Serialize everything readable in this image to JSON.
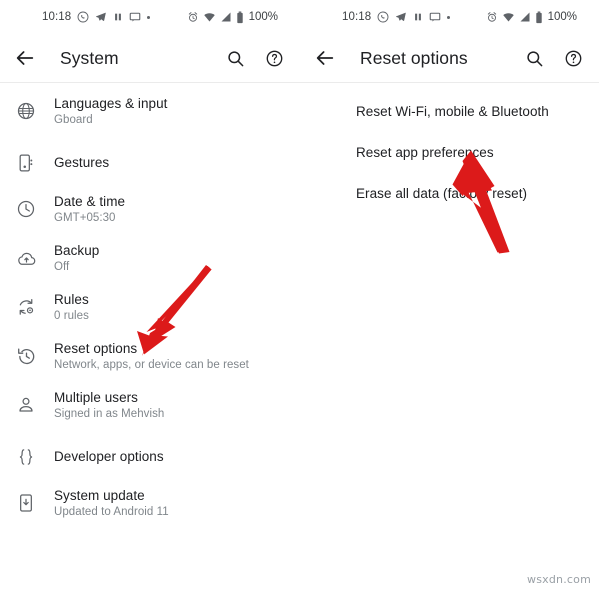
{
  "theme": {
    "accent_red": "#DC1A1A",
    "text_primary": "#202124",
    "text_secondary": "#80868b",
    "icon_color": "#5f6368",
    "background": "#ffffff",
    "divider": "#ebebeb"
  },
  "left_screen": {
    "status_bar": {
      "time": "10:18",
      "battery_percent": "100%",
      "left_icons": [
        "whatsapp-icon",
        "telegram-icon",
        "pause-icon",
        "message-icon",
        "more-notifications-dot"
      ],
      "right_icons": [
        "alarm-icon",
        "wifi-icon",
        "signal-icon",
        "battery-icon"
      ]
    },
    "app_bar": {
      "back_icon": "arrow-back-icon",
      "title": "System",
      "search_icon": "search-icon",
      "help_icon": "help-circle-icon"
    },
    "items": [
      {
        "icon": "globe-icon",
        "title": "Languages & input",
        "subtitle": "Gboard"
      },
      {
        "icon": "gestures-icon",
        "title": "Gestures",
        "subtitle": ""
      },
      {
        "icon": "clock-icon",
        "title": "Date & time",
        "subtitle": "GMT+05:30"
      },
      {
        "icon": "cloud-upload-icon",
        "title": "Backup",
        "subtitle": "Off"
      },
      {
        "icon": "rules-icon",
        "title": "Rules",
        "subtitle": "0 rules"
      },
      {
        "icon": "history-icon",
        "title": "Reset options",
        "subtitle": "Network, apps, or device can be reset"
      },
      {
        "icon": "person-icon",
        "title": "Multiple users",
        "subtitle": "Signed in as Mehvish"
      },
      {
        "icon": "braces-icon",
        "title": "Developer options",
        "subtitle": ""
      },
      {
        "icon": "system-update-icon",
        "title": "System update",
        "subtitle": "Updated to Android 11"
      }
    ]
  },
  "right_screen": {
    "status_bar": {
      "time": "10:18",
      "battery_percent": "100%",
      "left_icons": [
        "whatsapp-icon",
        "telegram-icon",
        "pause-icon",
        "message-icon",
        "more-notifications-dot"
      ],
      "right_icons": [
        "alarm-icon",
        "wifi-icon",
        "signal-icon",
        "battery-icon"
      ]
    },
    "app_bar": {
      "back_icon": "arrow-back-icon",
      "title": "Reset options",
      "search_icon": "search-icon",
      "help_icon": "help-circle-icon"
    },
    "items": [
      {
        "title": "Reset Wi-Fi, mobile & Bluetooth"
      },
      {
        "title": "Reset app preferences"
      },
      {
        "title": "Erase all data (factory reset)"
      }
    ]
  },
  "annotations": [
    {
      "name": "arrow-to-reset-options",
      "color": "#DC1A1A",
      "points_to": "Reset options"
    },
    {
      "name": "arrow-to-reset-app-prefs",
      "color": "#DC1A1A",
      "points_to": "Reset app preferences"
    }
  ],
  "watermark": "wsxdn.com"
}
